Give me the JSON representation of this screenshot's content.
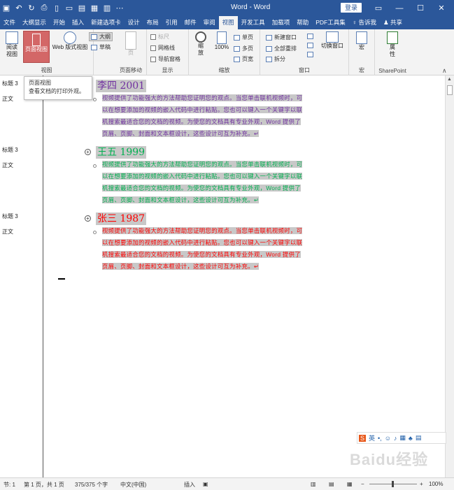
{
  "window": {
    "title": "Word - Word",
    "login_label": "登录"
  },
  "tabs": [
    {
      "label": "文件"
    },
    {
      "label": "大纲显示"
    },
    {
      "label": "开始"
    },
    {
      "label": "插入"
    },
    {
      "label": "新建选项卡"
    },
    {
      "label": "设计"
    },
    {
      "label": "布局"
    },
    {
      "label": "引用"
    },
    {
      "label": "邮件"
    },
    {
      "label": "审阅"
    },
    {
      "label": "视图"
    },
    {
      "label": "开发工具"
    },
    {
      "label": "加载项"
    },
    {
      "label": "帮助"
    },
    {
      "label": "PDF工具集"
    },
    {
      "label": "告诉我"
    },
    {
      "label": "共享"
    }
  ],
  "ribbon": {
    "views": {
      "read_mode": "阅读\n视图",
      "print_layout": "页面视图",
      "web_layout": "Web 版式视图",
      "outline": "大纲",
      "draft": "草稿",
      "group": "视图"
    },
    "page_move": {
      "page": "页",
      "group": "页面移动"
    },
    "show": {
      "ruler": "标尺",
      "gridlines": "网格线",
      "nav_pane": "导航窗格",
      "group": "显示"
    },
    "zoom": {
      "zoom": "缩\n放",
      "zoom100": "100%",
      "one_page": "单页",
      "multi_page": "多页",
      "page_width": "页宽",
      "group": "缩放"
    },
    "window": {
      "new_window": "新建窗口",
      "arrange_all": "全部重排",
      "split": "拆分",
      "switch": "切换窗口",
      "group": "窗口"
    },
    "macro": {
      "label": "宏",
      "group": "宏"
    },
    "sharepoint": {
      "label": "属\n性",
      "group": "SharePoint"
    }
  },
  "tooltip": {
    "title": "页面视图",
    "desc": "查看文档的打印外观。"
  },
  "outline_levels": [
    {
      "label": "标题 3"
    },
    {
      "label": "正文"
    },
    {
      "label": "标题 3"
    },
    {
      "label": "正文"
    },
    {
      "label": "标题 3"
    },
    {
      "label": "正文"
    }
  ],
  "sections": [
    {
      "heading": "李四 2001",
      "color": "#7030a0",
      "lines": [
        "视频提供了功能强大的方法帮助您证明您的观点。当您单击联机视频时，可",
        "以在想要添加的视频的嵌入代码中进行粘贴。您也可以键入一个关键字以联",
        "机搜索最适合您的文档的视频。为使您的文档具有专业外观，Word 提供了",
        "页眉、页脚、封面和文本框设计，这些设计可互为补充。↵"
      ]
    },
    {
      "heading": "王五 1999",
      "color": "#00b050",
      "lines": [
        "视频提供了功能强大的方法帮助您证明您的观点。当您单击联机视频时，可",
        "以在想要添加的视频的嵌入代码中进行粘贴。您也可以键入一个关键字以联",
        "机搜索最适合您的文档的视频。为使您的文档具有专业外观，Word 提供了",
        "页眉、页脚、封面和文本框设计，这些设计可互为补充。↵"
      ]
    },
    {
      "heading": "张三 1987",
      "color": "#ff0000",
      "lines": [
        "视频提供了功能强大的方法帮助您证明您的观点。当您单击联机视频时，可",
        "以在想要添加的视频的嵌入代码中进行粘贴。您也可以键入一个关键字以联",
        "机搜索最适合您的文档的视频。为使您的文档具有专业外观，Word 提供了",
        "页眉、页脚、封面和文本框设计，这些设计可互为补充。↵"
      ]
    }
  ],
  "status": {
    "section": "节: 1",
    "page": "第 1 页，共 1 页",
    "words": "375/375 个字",
    "lang": "中文(中国)",
    "insert": "插入",
    "zoom": "100%"
  },
  "ime": {
    "label": "英"
  },
  "watermark": "Baidu经验"
}
